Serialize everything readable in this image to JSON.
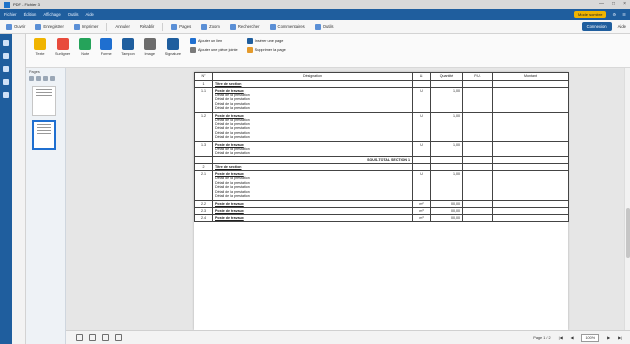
{
  "window": {
    "title": "PDF - Fichier 3",
    "controls": [
      "—",
      "□",
      "×"
    ]
  },
  "menubar": {
    "items": [
      "Fichier",
      "Édition",
      "Affichage",
      "Outils",
      "Aide"
    ],
    "right_pill": "Mode sombre",
    "right_icons": [
      "⚙",
      "☰"
    ]
  },
  "tabs": {
    "items": [
      {
        "label": "Ouvrir"
      },
      {
        "label": "Enregistrer"
      },
      {
        "label": "Imprimer"
      },
      {
        "label": "Annuler"
      },
      {
        "label": "Rétablir"
      },
      {
        "label": "Pages"
      },
      {
        "label": "Zoom"
      },
      {
        "label": "Rechercher"
      },
      {
        "label": "Commentaires"
      },
      {
        "label": "Outils"
      }
    ],
    "right": {
      "btn1": "Connexion",
      "btn2": "Aide"
    }
  },
  "toolbar": {
    "tools": [
      {
        "label": "Texte",
        "color": "#f0b400"
      },
      {
        "label": "Surligner",
        "color": "#e84b3c"
      },
      {
        "label": "Note",
        "color": "#25a35a"
      },
      {
        "label": "Forme",
        "color": "#1f6fd0"
      },
      {
        "label": "Tampon",
        "color": "#1f5e9e"
      },
      {
        "label": "Image",
        "color": "#6c6c6c"
      },
      {
        "label": "Signature",
        "color": "#1f5e9e"
      }
    ],
    "group1": [
      "Ajouter un lien",
      "Ajouter une pièce jointe"
    ],
    "group2": [
      "Insérer une page",
      "Supprimer la page"
    ]
  },
  "thumbs": {
    "header": "Pages"
  },
  "document": {
    "table": {
      "headers": [
        "N°",
        "Désignation",
        "U.",
        "Quantité",
        "P.U.",
        "Montant"
      ],
      "rows": [
        {
          "no": "1",
          "label": "Titre de section",
          "bold": true,
          "u": "",
          "q": "",
          "pu": "",
          "m": ""
        },
        {
          "no": "1.1",
          "label": "Poste de travaux",
          "bold": true,
          "detail": [
            "Détail de la prestation",
            "Détail de la prestation",
            "Détail de la prestation",
            "Détail de la prestation"
          ],
          "u": "U",
          "q": "1,00",
          "pu": "",
          "m": ""
        },
        {
          "no": "1.2",
          "label": "Poste de travaux",
          "bold": true,
          "detail": [
            "Détail de la prestation",
            "Détail de la prestation",
            "Détail de la prestation",
            "Détail de la prestation",
            "Détail de la prestation"
          ],
          "u": "U",
          "q": "1,00",
          "pu": "",
          "m": ""
        },
        {
          "no": "1.3",
          "label": "Poste de travaux",
          "bold": true,
          "detail": [
            "Détail de la prestation",
            "Détail de la prestation"
          ],
          "u": "U",
          "q": "1,00",
          "pu": "",
          "m": ""
        },
        {
          "no": "",
          "label": "SOUS-TOTAL SECTION 1",
          "total": true,
          "u": "",
          "q": "",
          "pu": "",
          "m": ""
        },
        {
          "no": "2",
          "label": "Titre de section",
          "bold": true,
          "u": "",
          "q": "",
          "pu": "",
          "m": ""
        },
        {
          "no": "2.1",
          "label": "Poste de travaux",
          "bold": true,
          "detail": [
            "Détail de la prestation",
            "Détail de la prestation",
            "Détail de la prestation",
            "Détail de la prestation",
            "Détail de la prestation"
          ],
          "u": "U",
          "q": "1,00",
          "pu": "",
          "m": ""
        },
        {
          "no": "2.2",
          "label": "Poste de travaux",
          "bold": true,
          "u": "m²",
          "q": "00,00",
          "pu": "",
          "m": ""
        },
        {
          "no": "2.3",
          "label": "Poste de travaux",
          "bold": true,
          "u": "m³",
          "q": "00,00",
          "pu": "",
          "m": ""
        },
        {
          "no": "2.4",
          "label": "Poste de travaux",
          "bold": true,
          "u": "m³",
          "q": "00,00",
          "pu": "",
          "m": ""
        }
      ]
    }
  },
  "statusbar": {
    "page_info": "Page 1 / 2",
    "zoom": "100%",
    "nav": [
      "|◀",
      "◀",
      "▶",
      "▶|"
    ]
  }
}
